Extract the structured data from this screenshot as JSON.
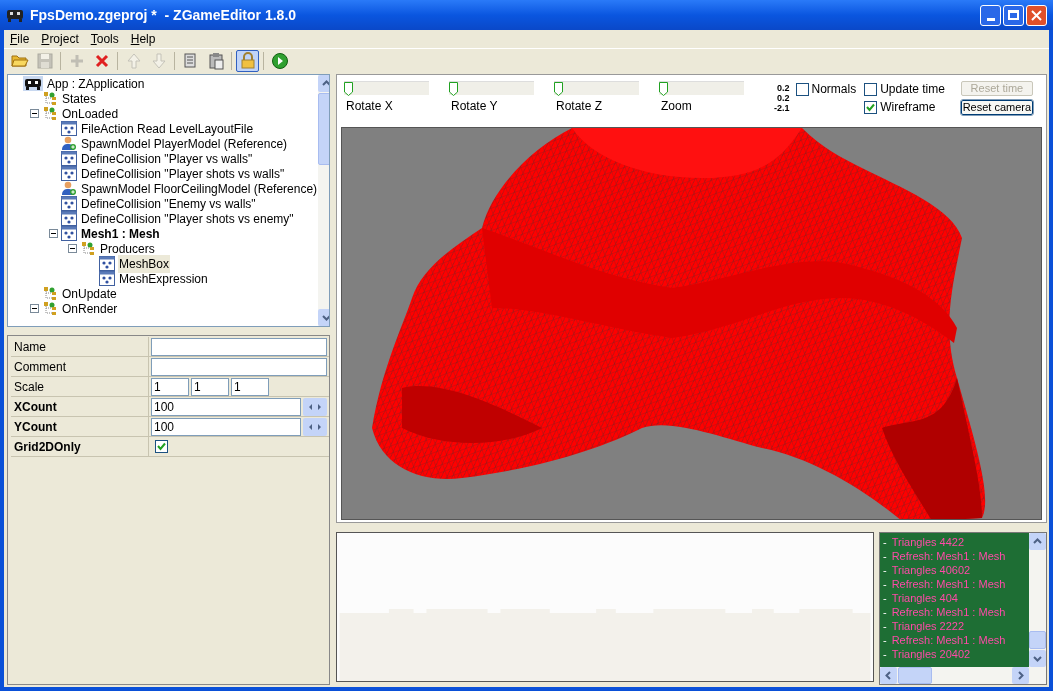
{
  "window": {
    "title": "FpsDemo.zgeproj *  - ZGameEditor 1.8.0"
  },
  "menu": [
    {
      "label": "File"
    },
    {
      "label": "Project"
    },
    {
      "label": "Tools"
    },
    {
      "label": "Help"
    }
  ],
  "toolbar": [
    {
      "kind": "open",
      "disabled": false,
      "selected": false
    },
    {
      "kind": "save",
      "disabled": true,
      "selected": false
    },
    {
      "kind": "sep"
    },
    {
      "kind": "add",
      "disabled": true,
      "selected": false
    },
    {
      "kind": "delete",
      "disabled": false,
      "selected": false
    },
    {
      "kind": "sep"
    },
    {
      "kind": "up",
      "disabled": true,
      "selected": false
    },
    {
      "kind": "down",
      "disabled": true,
      "selected": false
    },
    {
      "kind": "sep"
    },
    {
      "kind": "copy",
      "disabled": false,
      "selected": false
    },
    {
      "kind": "paste",
      "disabled": false,
      "selected": false
    },
    {
      "kind": "sep"
    },
    {
      "kind": "lock",
      "disabled": false,
      "selected": true
    },
    {
      "kind": "sep"
    },
    {
      "kind": "run",
      "disabled": false,
      "selected": false
    }
  ],
  "tree": [
    {
      "kind": "app",
      "label": "App : ZApplication",
      "bold": false,
      "selected": false,
      "children": [
        {
          "kind": "group",
          "label": "States",
          "bold": false,
          "selected": false
        },
        {
          "kind": "group",
          "label": "OnLoaded",
          "bold": false,
          "selected": false,
          "expanded": true,
          "children": [
            {
              "kind": "component",
              "label": "FileAction  Read LevelLayoutFile",
              "bold": false,
              "selected": false
            },
            {
              "kind": "model",
              "label": "SpawnModel  PlayerModel (Reference)",
              "bold": false,
              "selected": false
            },
            {
              "kind": "component",
              "label": "DefineCollision \"Player vs walls\"",
              "bold": false,
              "selected": false
            },
            {
              "kind": "component",
              "label": "DefineCollision \"Player shots vs walls\"",
              "bold": false,
              "selected": false
            },
            {
              "kind": "model",
              "label": "SpawnModel  FloorCeilingModel (Reference)",
              "bold": false,
              "selected": false
            },
            {
              "kind": "component",
              "label": "DefineCollision \"Enemy vs walls\"",
              "bold": false,
              "selected": false
            },
            {
              "kind": "component",
              "label": "DefineCollision \"Player shots vs enemy\"",
              "bold": false,
              "selected": false
            },
            {
              "kind": "component",
              "label": "Mesh1 : Mesh",
              "bold": true,
              "selected": false,
              "expanded": true,
              "children": [
                {
                  "kind": "group",
                  "label": "Producers",
                  "bold": false,
                  "selected": false,
                  "expanded": true,
                  "children": [
                    {
                      "kind": "component",
                      "label": "MeshBox",
                      "bold": false,
                      "selected": true
                    },
                    {
                      "kind": "component",
                      "label": "MeshExpression",
                      "bold": false,
                      "selected": false
                    }
                  ]
                }
              ]
            }
          ]
        },
        {
          "kind": "group",
          "label": "OnUpdate",
          "bold": false,
          "selected": false
        },
        {
          "kind": "group",
          "label": "OnRender",
          "bold": false,
          "selected": false,
          "expanded": true
        }
      ]
    }
  ],
  "properties": [
    {
      "kind": "text",
      "label": "Name",
      "bold": false
    },
    {
      "kind": "text",
      "label": "Comment",
      "bold": false
    },
    {
      "kind": "vector",
      "label": "Scale",
      "bold": false,
      "values": [
        "1",
        "1",
        "1"
      ]
    },
    {
      "kind": "spin",
      "label": "XCount",
      "bold": true,
      "value": "100"
    },
    {
      "kind": "spin",
      "label": "YCount",
      "bold": true,
      "value": "100"
    },
    {
      "kind": "checkbox",
      "label": "Grid2DOnly",
      "bold": true,
      "checked": true
    }
  ],
  "preview": {
    "sliders": [
      {
        "label": "Rotate X",
        "level": 0
      },
      {
        "label": "Rotate Y",
        "level": 0
      },
      {
        "label": "Rotate Z",
        "level": 0
      },
      {
        "label": "Zoom",
        "level": 0
      }
    ],
    "readouts": [
      "0.2",
      "0.2",
      "-2.1"
    ],
    "checkboxes": [
      {
        "label": "Normals",
        "checked": false
      },
      {
        "label": "Update time",
        "checked": false
      },
      {
        "label": "Wireframe",
        "checked": true
      }
    ],
    "buttons": [
      {
        "label": "Reset time",
        "disabled": true
      },
      {
        "label": "Reset camera",
        "disabled": false
      }
    ],
    "viewport": {
      "kind": "picture"
    }
  },
  "log": [
    {
      "bullet": "-",
      "text": "Triangles 4422"
    },
    {
      "bullet": "-",
      "text": "Refresh: Mesh1 : Mesh"
    },
    {
      "bullet": "-",
      "text": "Triangles 40602"
    },
    {
      "bullet": "-",
      "text": "Refresh: Mesh1 : Mesh"
    },
    {
      "bullet": "-",
      "text": "Triangles 404"
    },
    {
      "bullet": "-",
      "text": "Refresh: Mesh1 : Mesh"
    },
    {
      "bullet": "-",
      "text": "Triangles 2222"
    },
    {
      "bullet": "-",
      "text": "Refresh: Mesh1 : Mesh"
    },
    {
      "bullet": "-",
      "text": "Triangles 20402"
    }
  ]
}
